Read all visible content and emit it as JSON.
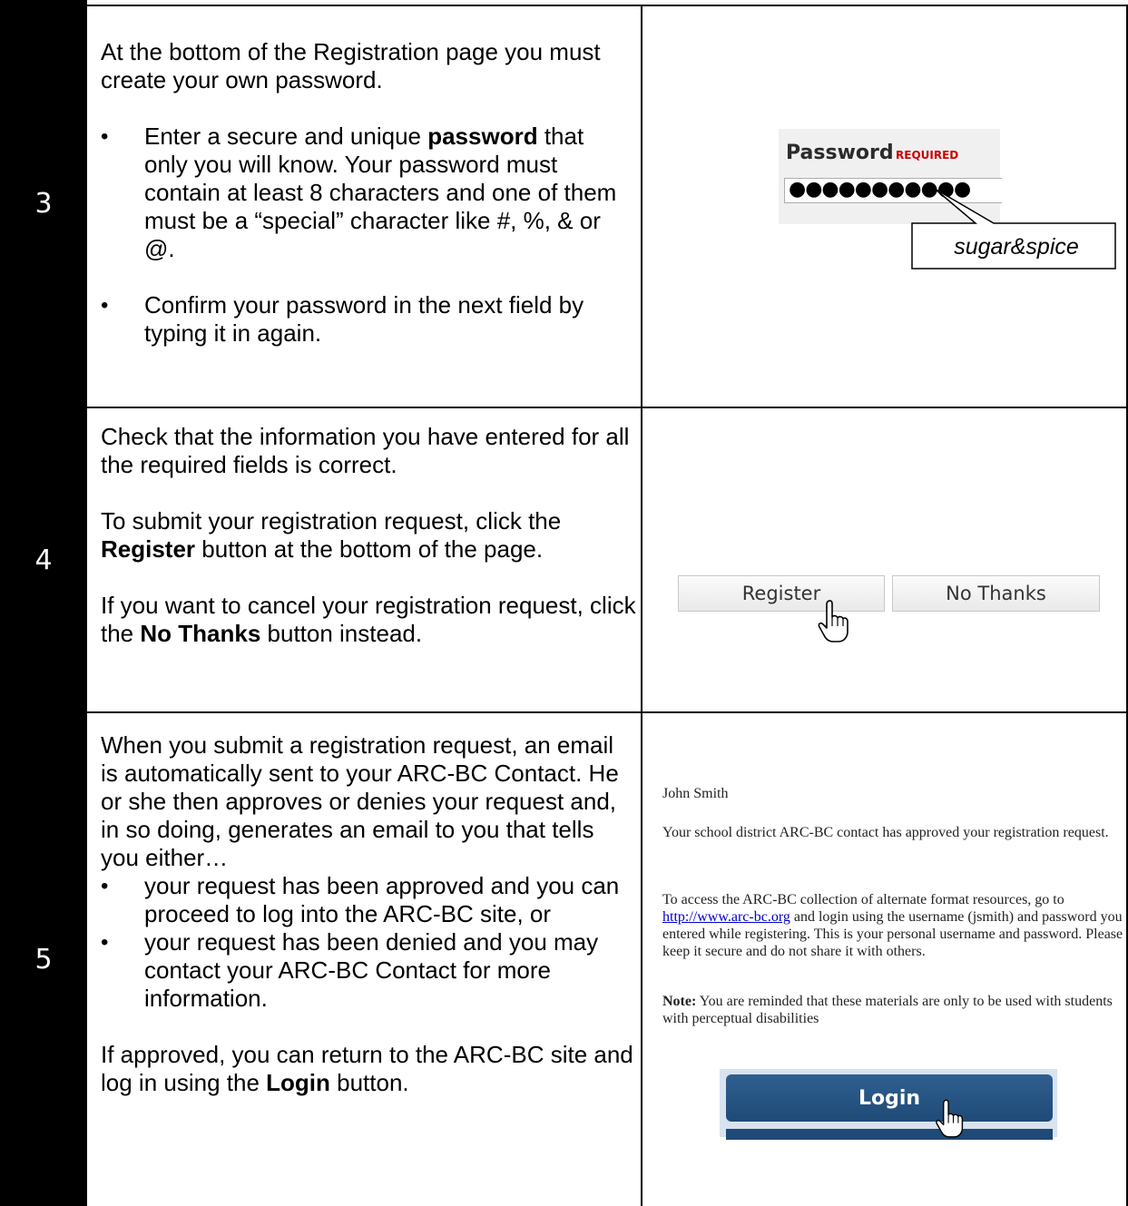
{
  "rows": [
    {
      "step": "3",
      "intro": "At the bottom of the Registration page you must create your own password.",
      "bullet1_pre": "Enter a secure and unique ",
      "bullet1_bold": "password",
      "bullet1_post": " that only you will know.  Your password must contain at least 8 characters and one of them must be a “special” character like #, %, & or @.",
      "bullet2": "Confirm your password in the next field by typing it in again."
    },
    {
      "step": "4",
      "para1": "Check that the information you have entered for all the required fields is correct.",
      "para2_pre": "To submit your registration request, click the ",
      "para2_bold": "Register",
      "para2_post": " button at the bottom of the page.",
      "para3_pre": "If you want to cancel your registration request, click the ",
      "para3_bold": "No Thanks",
      "para3_post": " button instead."
    },
    {
      "step": "5",
      "intro": "When you submit a registration request, an email is automatically sent to your ARC-BC Contact.  He or she then approves or denies your request and, in so doing, generates an email to you that tells you either…",
      "bullet1": "your request has been approved and you can proceed to log into the ARC-BC site, or",
      "bullet2": "your request has been denied and you may contact your ARC-BC Contact for more information.",
      "outro_pre": "If approved, you can return to the ARC-BC site and log in using the ",
      "outro_bold": "Login",
      "outro_post": " button."
    }
  ],
  "password_widget": {
    "label": "Password",
    "required": "REQUIRED",
    "masked_value": "●●●●●●●●●●●",
    "callout": "sugar&spice"
  },
  "register_buttons": {
    "register": "Register",
    "no_thanks": "No Thanks"
  },
  "email": {
    "name": "John Smith",
    "p1": "Your school district ARC-BC contact has approved your registration request.",
    "p2_pre": "To access the ARC-BC collection of alternate format resources, go to ",
    "p2_link": "http://www.arc-bc.org",
    "p2_post": " and login using the username (jsmith) and password you entered while registering. This is your personal username and password. Please keep it secure and do not share it with others.",
    "note_bold": "Note:",
    "note_text": " You are reminded that these materials are only to be used with students with perceptual disabilities"
  },
  "login_button": "Login"
}
